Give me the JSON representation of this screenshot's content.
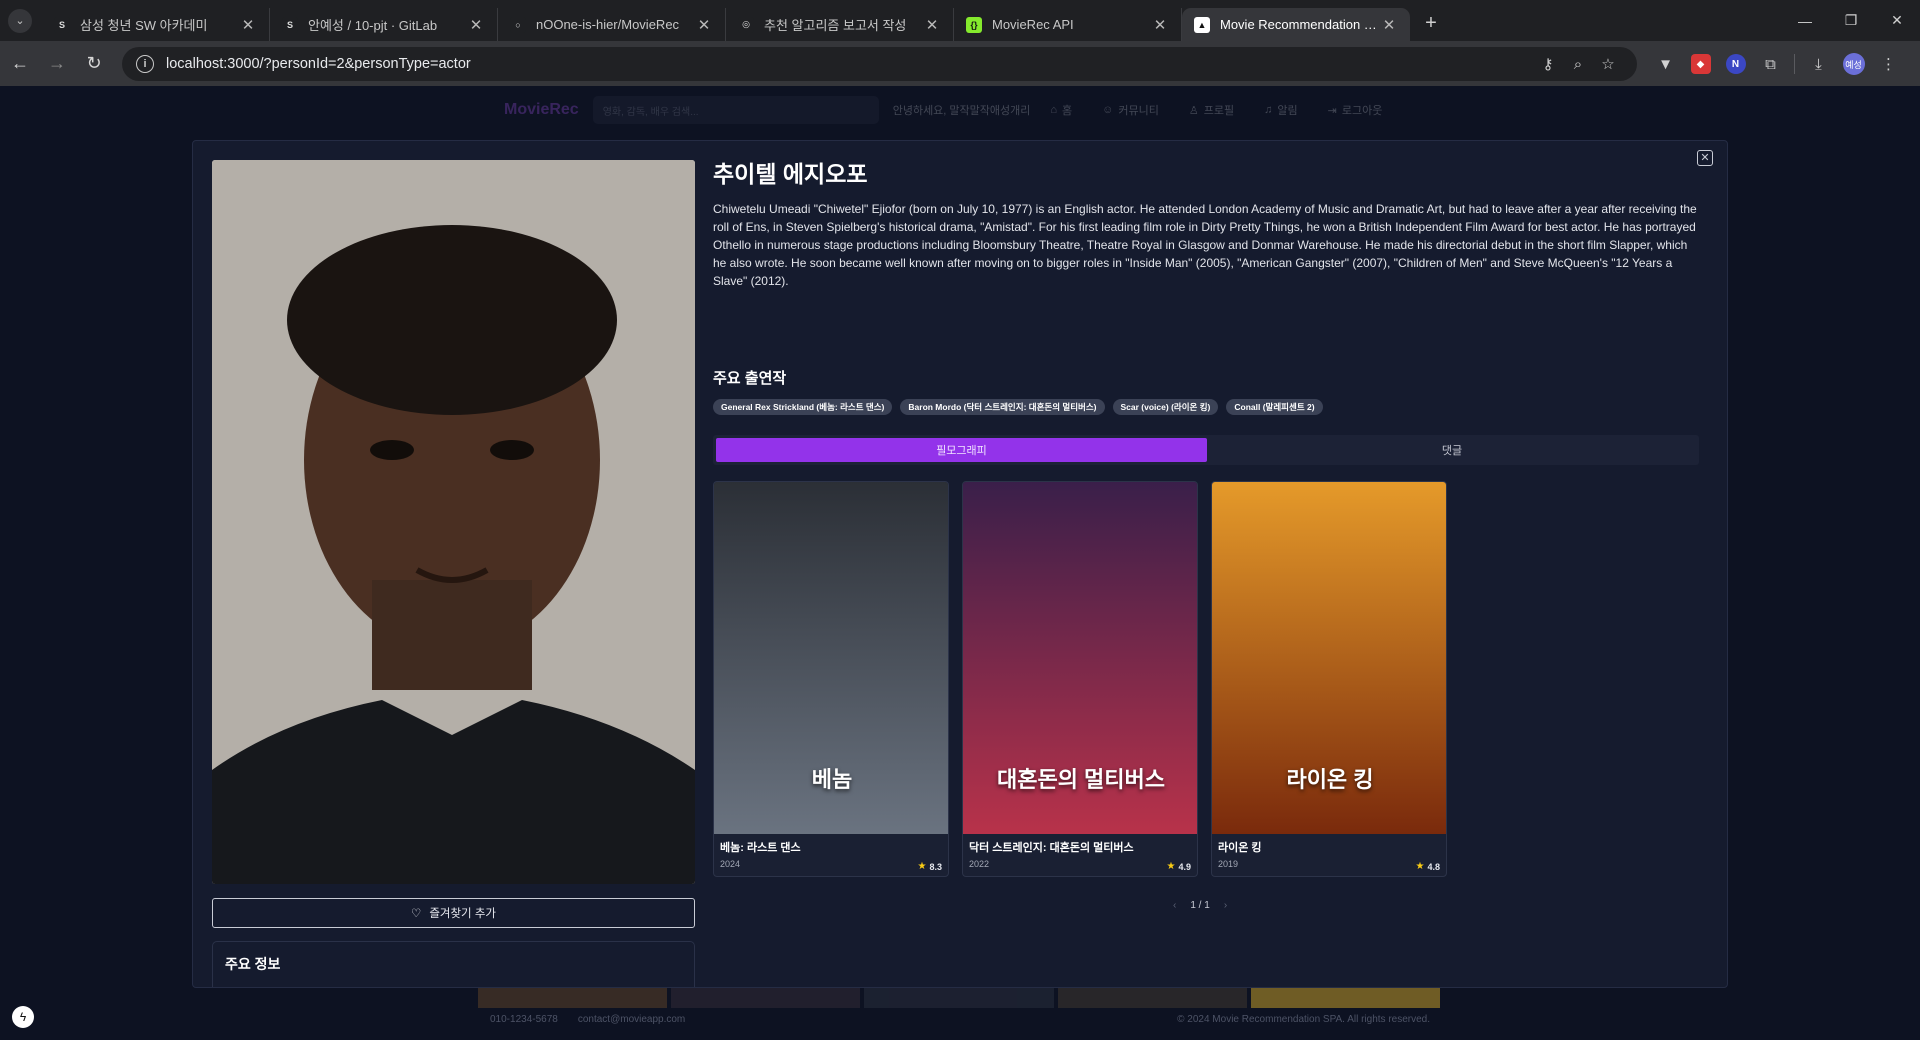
{
  "browser": {
    "tabs": [
      {
        "title": "삼성 청년 SW 아카데미",
        "icon": "ssafy-icon",
        "color": "#1f2023",
        "glyph": "S"
      },
      {
        "title": "안예성 / 10-pjt · GitLab",
        "icon": "gitlab-icon",
        "color": "#1f2023",
        "glyph": "S"
      },
      {
        "title": "nOOne-is-hier/MovieRec",
        "icon": "github-icon",
        "color": "#1f2023",
        "glyph": "○"
      },
      {
        "title": "추천 알고리즘 보고서 작성",
        "icon": "openai-icon",
        "color": "#1f2023",
        "glyph": "◎"
      },
      {
        "title": "MovieRec API",
        "icon": "swagger-icon",
        "color": "#85ea2d",
        "glyph": "{}"
      },
      {
        "title": "Movie Recommendation SPA",
        "icon": "vercel-icon",
        "color": "#ffffff",
        "glyph": "▲"
      }
    ],
    "url": "localhost:3000/?personId=2&personType=actor"
  },
  "app": {
    "brand": "MovieRec",
    "search_placeholder": "영화, 감독, 배우 검색...",
    "greeting": "안녕하세요, 말작말작애성개리",
    "nav": [
      {
        "label": "홈",
        "icon": "home-icon"
      },
      {
        "label": "커뮤니티",
        "icon": "community-icon"
      },
      {
        "label": "프로필",
        "icon": "profile-icon"
      },
      {
        "label": "알림",
        "icon": "bell-icon"
      },
      {
        "label": "로그아웃",
        "icon": "logout-icon"
      }
    ],
    "footer_phone": "010-1234-5678",
    "footer_email": "contact@movieapp.com",
    "footer_copy": "© 2024 Movie Recommendation SPA. All rights reserved."
  },
  "person": {
    "name": "추이텔 에지오포",
    "bio": "Chiwetelu Umeadi \"Chiwetel\" Ejiofor (born on July 10, 1977) is an English actor. He attended London Academy of Music and Dramatic Art, but had to leave after a year after receiving the roll of Ens, in Steven Spielberg's historical drama, \"Amistad\". For his first leading film role in Dirty Pretty Things, he won a British Independent Film Award for best actor. He has portrayed Othello in numerous stage productions including Bloomsbury Theatre, Theatre Royal in Glasgow and Donmar Warehouse. He made his directorial debut in the short film Slapper, which he also wrote. He soon became well known after moving on to bigger roles in \"Inside Man\" (2005), \"American Gangster\" (2007), \"Children of Men\" and Steve McQueen's \"12 Years a Slave\" (2012).",
    "favorite_label": "즐겨찾기 추가",
    "info_title": "주요 정보",
    "roles_title": "주요 출연작",
    "roles": [
      "General Rex Strickland (베놈: 라스트 댄스)",
      "Baron Mordo (닥터 스트레인지: 대혼돈의 멀티버스)",
      "Scar (voice) (라이온 킹)",
      "Conall (말레피센트 2)"
    ]
  },
  "tabs": {
    "filmography": "필모그래피",
    "comments": "댓글"
  },
  "movies": [
    {
      "title": "베놈: 라스트 댄스",
      "year": "2024",
      "rating": "8.3",
      "poster_text": "베놈",
      "colors": [
        "#2b2f36",
        "#6a7380"
      ]
    },
    {
      "title": "닥터 스트레인지: 대혼돈의 멀티버스",
      "year": "2022",
      "rating": "4.9",
      "poster_text": "대혼돈의 멀티버스",
      "colors": [
        "#3a1f4a",
        "#b8324a"
      ]
    },
    {
      "title": "라이온 킹",
      "year": "2019",
      "rating": "4.8",
      "poster_text": "라이온 킹",
      "colors": [
        "#e59a2a",
        "#7a2a0c"
      ]
    }
  ],
  "pager": {
    "label": "1 / 1"
  }
}
